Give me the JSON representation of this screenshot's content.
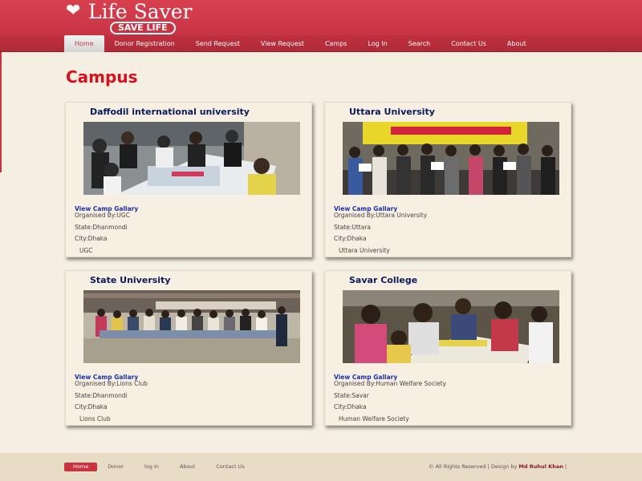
{
  "brand": {
    "title": "Life Saver",
    "badge": "SAVE LIFE"
  },
  "nav": {
    "items": [
      {
        "label": "Home",
        "active": true
      },
      {
        "label": "Donor Registration"
      },
      {
        "label": "Send Request"
      },
      {
        "label": "View Request"
      },
      {
        "label": "Camps"
      },
      {
        "label": "Log In"
      },
      {
        "label": "Search"
      },
      {
        "label": "Contact Us"
      },
      {
        "label": "About"
      }
    ]
  },
  "page": {
    "title": "Campus"
  },
  "camps": [
    {
      "title": "Daffodil international university",
      "photo_icon": "camp-photo",
      "link": "View Camp Gallary",
      "organised": "Organised By:UGC",
      "state": "State:Dhanmondi",
      "city": "City:Dhaka",
      "organiser": "UGC"
    },
    {
      "title": "Uttara University",
      "photo_icon": "camp-photo",
      "link": "View Camp Gallary",
      "organised": "Organised By:Uttara University",
      "state": "State:Uttara",
      "city": "City:Dhaka",
      "organiser": "Uttara University"
    },
    {
      "title": "State University",
      "photo_icon": "camp-photo",
      "link": "View Camp Gallary",
      "organised": "Organised By:Lions Club",
      "state": "State:Dhanmondi",
      "city": "City:Dhaka",
      "organiser": "Lions Club"
    },
    {
      "title": "Savar College",
      "photo_icon": "camp-photo",
      "link": "View Camp Gallary",
      "organised": "Organised By:Human Welfare Society",
      "state": "State:Savar",
      "city": "City:Dhaka",
      "organiser": "Human Welfare Society"
    }
  ],
  "footer": {
    "links": [
      {
        "label": "Home",
        "active": true
      },
      {
        "label": "Donor"
      },
      {
        "label": "log In"
      },
      {
        "label": "About"
      },
      {
        "label": "Contact Us"
      }
    ],
    "copyright_prefix": "© All Rights Reserved | Design by ",
    "designer": "Md Ruhul Khan",
    "copyright_suffix": " |"
  },
  "colors": {
    "brand": "#c83444",
    "title": "#d7101c",
    "card_title": "#0a1a5e",
    "link": "#1c2fb0"
  }
}
